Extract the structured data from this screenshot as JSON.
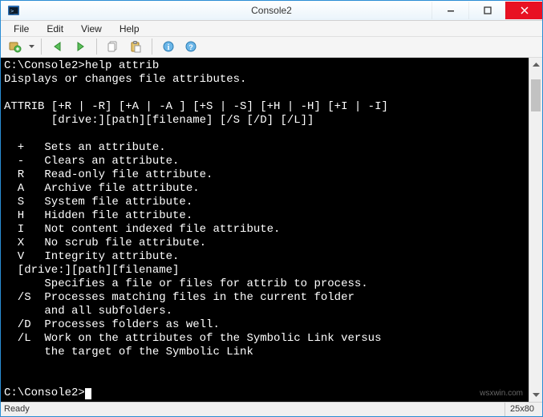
{
  "window": {
    "title": "Console2"
  },
  "menu": {
    "file": "File",
    "edit": "Edit",
    "view": "View",
    "help": "Help"
  },
  "terminal": {
    "prompt1": "C:\\Console2>",
    "command1": "help attrib",
    "l1": "Displays or changes file attributes.",
    "l2": "ATTRIB [+R | -R] [+A | -A ] [+S | -S] [+H | -H] [+I | -I]",
    "l3": "       [drive:][path][filename] [/S [/D] [/L]]",
    "l4": "  +   Sets an attribute.",
    "l5": "  -   Clears an attribute.",
    "l6": "  R   Read-only file attribute.",
    "l7": "  A   Archive file attribute.",
    "l8": "  S   System file attribute.",
    "l9": "  H   Hidden file attribute.",
    "l10": "  I   Not content indexed file attribute.",
    "l11": "  X   No scrub file attribute.",
    "l12": "  V   Integrity attribute.",
    "l13": "  [drive:][path][filename]",
    "l14": "      Specifies a file or files for attrib to process.",
    "l15": "  /S  Processes matching files in the current folder",
    "l16": "      and all subfolders.",
    "l17": "  /D  Processes folders as well.",
    "l18": "  /L  Work on the attributes of the Symbolic Link versus",
    "l19": "      the target of the Symbolic Link",
    "prompt2": "C:\\Console2>"
  },
  "status": {
    "left": "Ready",
    "right": "25x80"
  },
  "watermark": "wsxwin.com"
}
